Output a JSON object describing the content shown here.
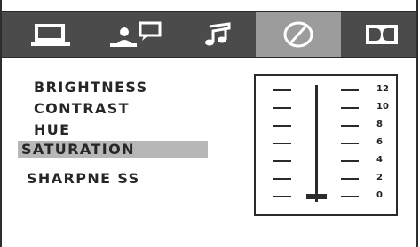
{
  "tabs": [
    {
      "icon": "monitor-icon",
      "active": false
    },
    {
      "icon": "speech-person-icon",
      "active": false
    },
    {
      "icon": "music-note-icon",
      "active": false
    },
    {
      "icon": "picture-settings-icon",
      "active": true
    },
    {
      "icon": "dolby-icon",
      "active": false
    }
  ],
  "menu": {
    "items": [
      {
        "label": "BRIGHTNESS",
        "selected": false
      },
      {
        "label": "CONTRAST",
        "selected": false
      },
      {
        "label": "HUE",
        "selected": false
      },
      {
        "label": "SATURATION",
        "selected": true
      },
      {
        "label": "SHARPNE SS",
        "selected": false
      }
    ]
  },
  "slider": {
    "scale": [
      "12",
      "10",
      "8",
      "6",
      "4",
      "2",
      "0"
    ],
    "value": 0,
    "min": 0,
    "max": 12
  },
  "colors": {
    "tabbar": "#4b4b4b",
    "active_tab": "#9c9c9c",
    "selected_item": "#b7b7b7",
    "text": "#262626"
  }
}
